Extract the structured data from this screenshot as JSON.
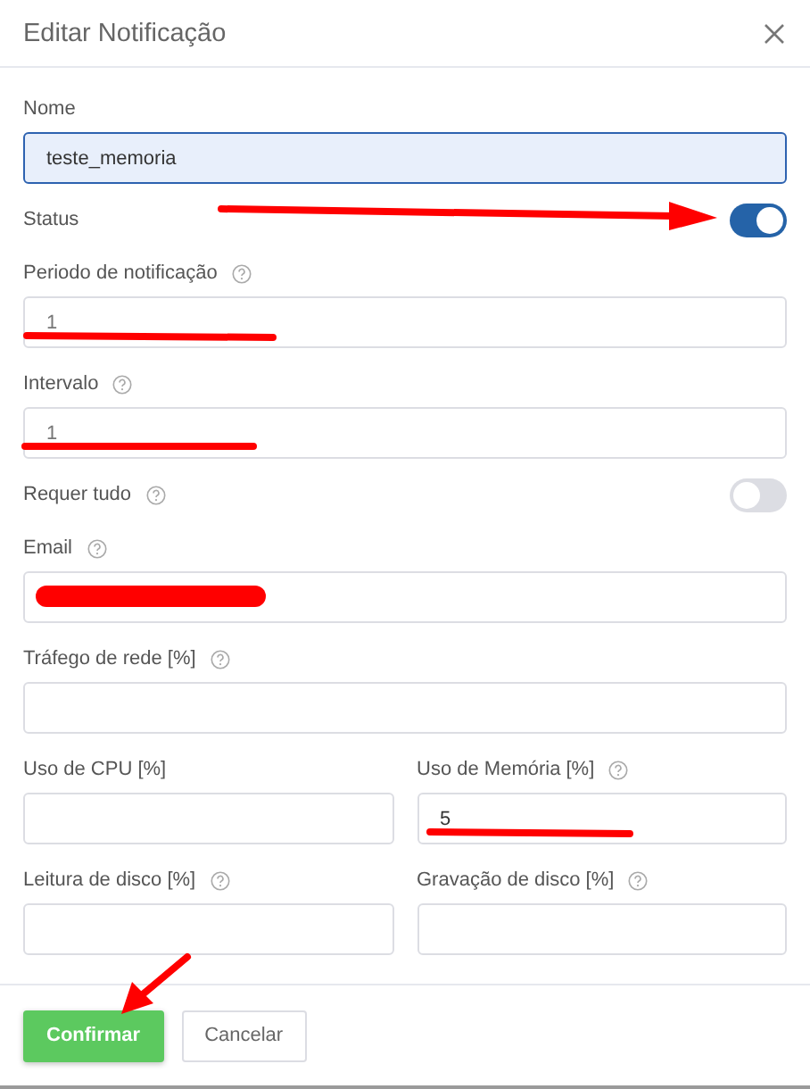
{
  "dialog": {
    "title": "Editar Notificação"
  },
  "rows": [
    {
      "fields": [
        {
          "kind": "text",
          "label": "Nome",
          "help": false,
          "value": "teste_memoria",
          "focused": true,
          "redacted": false
        }
      ]
    },
    {
      "fields": [
        {
          "kind": "toggle",
          "label": "Status",
          "help": false,
          "on": true
        }
      ]
    },
    {
      "fields": [
        {
          "kind": "text",
          "label": "Periodo de notificação",
          "help": true,
          "placeholder": "1",
          "focused": false,
          "redacted": false
        }
      ]
    },
    {
      "fields": [
        {
          "kind": "text",
          "label": "Intervalo",
          "help": true,
          "placeholder": "1",
          "focused": false,
          "redacted": false
        }
      ]
    },
    {
      "fields": [
        {
          "kind": "toggle",
          "label": "Requer tudo",
          "help": true,
          "on": false
        }
      ]
    },
    {
      "fields": [
        {
          "kind": "text",
          "label": "Email",
          "help": true,
          "focused": false,
          "redacted": true
        }
      ]
    },
    {
      "fields": [
        {
          "kind": "text",
          "label": "Tráfego de rede [%]",
          "help": true,
          "focused": false,
          "redacted": false
        }
      ]
    },
    {
      "fields": [
        {
          "kind": "text",
          "label": "Uso de CPU [%]",
          "help": false,
          "focused": false,
          "redacted": false
        },
        {
          "kind": "text",
          "label": "Uso de Memória [%]",
          "help": true,
          "value": "5",
          "focused": false,
          "redacted": false
        }
      ]
    },
    {
      "fields": [
        {
          "kind": "text",
          "label": "Leitura de disco [%]",
          "help": true,
          "focused": false,
          "redacted": false
        },
        {
          "kind": "text",
          "label": "Gravação de disco [%]",
          "help": true,
          "focused": false,
          "redacted": false
        }
      ]
    }
  ],
  "buttons": [
    {
      "label": "Confirmar",
      "kind": "primary"
    },
    {
      "label": "Cancelar",
      "kind": "secondary"
    }
  ]
}
